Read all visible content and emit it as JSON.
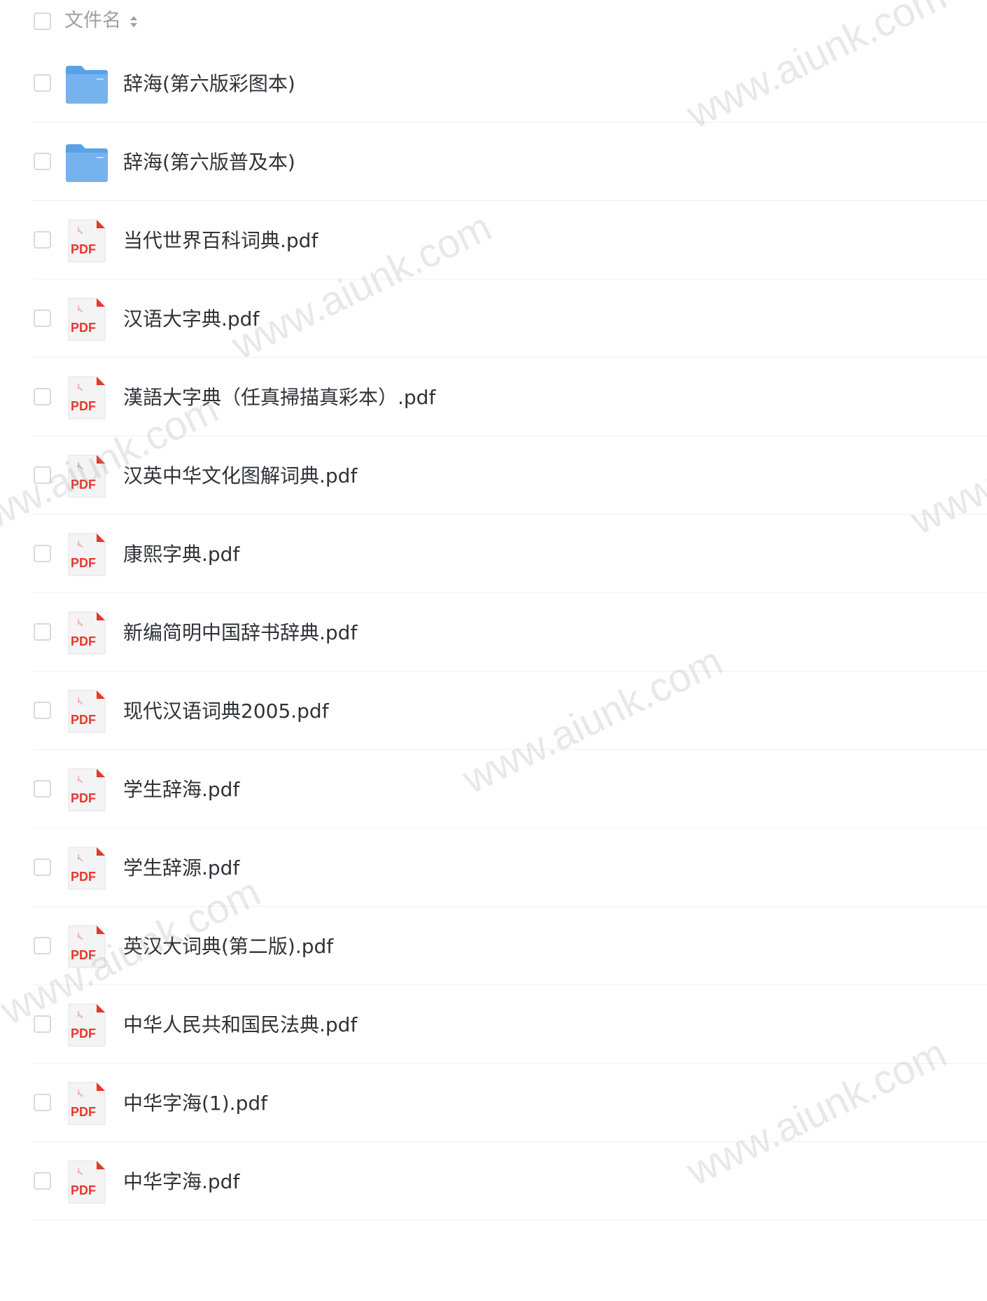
{
  "header": {
    "column_label": "文件名",
    "sort_icon": "sort-icon"
  },
  "files": [
    {
      "name": "辞海(第六版彩图本)",
      "type": "folder"
    },
    {
      "name": "辞海(第六版普及本)",
      "type": "folder"
    },
    {
      "name": "当代世界百科词典.pdf",
      "type": "pdf"
    },
    {
      "name": "汉语大字典.pdf",
      "type": "pdf"
    },
    {
      "name": "漢語大字典（任真掃描真彩本）.pdf",
      "type": "pdf"
    },
    {
      "name": "汉英中华文化图解词典.pdf",
      "type": "pdf"
    },
    {
      "name": "康熙字典.pdf",
      "type": "pdf"
    },
    {
      "name": "新编简明中国辞书辞典.pdf",
      "type": "pdf"
    },
    {
      "name": "现代汉语词典2005.pdf",
      "type": "pdf"
    },
    {
      "name": "学生辞海.pdf",
      "type": "pdf"
    },
    {
      "name": "学生辞源.pdf",
      "type": "pdf"
    },
    {
      "name": "英汉大词典(第二版).pdf",
      "type": "pdf"
    },
    {
      "name": "中华人民共和国民法典.pdf",
      "type": "pdf"
    },
    {
      "name": "中华字海(1).pdf",
      "type": "pdf"
    },
    {
      "name": "中华字海.pdf",
      "type": "pdf"
    }
  ],
  "pdf_badge": "PDF",
  "watermark": "www.aiunk.com",
  "colors": {
    "folder": "#74b3ee",
    "pdf_red": "#e8372c",
    "text": "#2f3338",
    "header_text": "#9aa0aa",
    "divider": "#eef0f3"
  }
}
